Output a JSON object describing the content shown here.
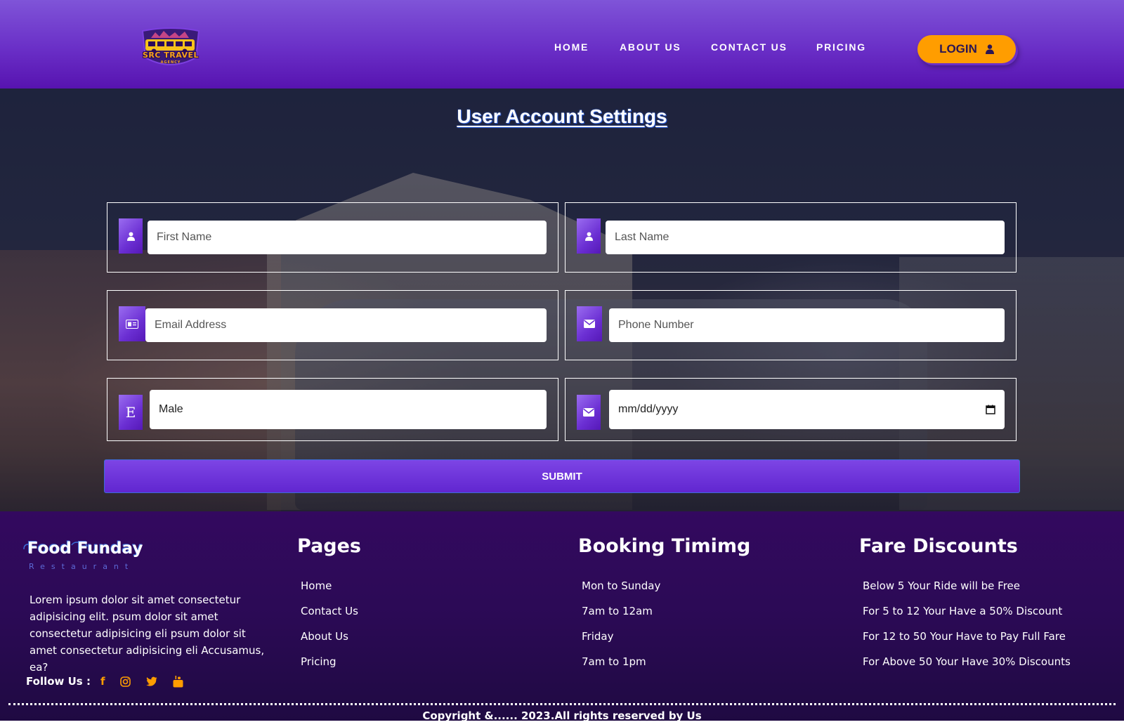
{
  "logo": {
    "title": "SRC TRAVEL",
    "subtitle": "AGENCY"
  },
  "nav": {
    "items": [
      "HOME",
      "ABOUT US",
      "CONTACT US",
      "PRICING"
    ],
    "login_label": "LOGIN"
  },
  "form": {
    "title": "User Account Settings",
    "first_name_placeholder": "First Name",
    "last_name_placeholder": "Last Name",
    "email_placeholder": "Email Address",
    "phone_placeholder": "Phone Number",
    "gender_value": "Male",
    "gender_icon_letter": "E",
    "date_placeholder": "mm/dd/yyyy",
    "submit_label": "SUBMIT"
  },
  "footer": {
    "brand": "Food Funday",
    "brand_sub": "Restaurant",
    "description": "Lorem ipsum dolor sit amet consectetur adipisicing elit. psum dolor sit amet consectetur adipisicing eli psum dolor sit amet consectetur adipisicing eli Accusamus, ea?",
    "follow_label": "Follow Us :",
    "columns": [
      {
        "title": "Pages",
        "items": [
          "Home",
          "Contact Us",
          "About Us",
          "Pricing"
        ]
      },
      {
        "title": "Booking Timimg",
        "items": [
          "Mon to Sunday",
          "7am to 12am",
          "Friday",
          "7am to 1pm"
        ]
      },
      {
        "title": "Fare Discounts",
        "items": [
          "Below 5 Your Ride will be Free",
          "For 5 to 12 Your Have a 50% Discount",
          "For 12 to 50 Your Have to Pay Full Fare",
          "For Above 50 Your Have 30% Discounts"
        ]
      }
    ],
    "copyright": "Copyright &...... 2023.All rights reserved by Us"
  },
  "colors": {
    "accent": "#ff9d00",
    "primary": "#6a2fc7",
    "footer_bg": "#2b0a55"
  },
  "icons": {
    "user": "user-icon",
    "id_card": "id-card-icon",
    "envelope": "envelope-icon",
    "calendar": "calendar-icon",
    "facebook": "facebook-icon",
    "instagram": "instagram-icon",
    "twitter": "twitter-icon",
    "youtube": "youtube-icon"
  }
}
